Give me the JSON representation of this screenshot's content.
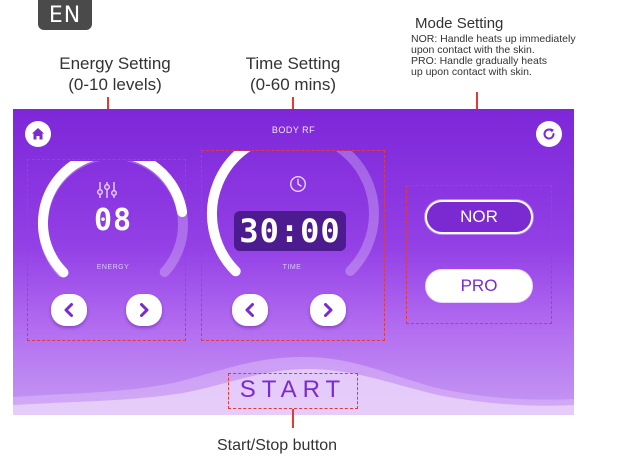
{
  "lang_badge": "EN",
  "callouts": {
    "energy": {
      "line1": "Energy Setting",
      "line2": "(0-10 levels)"
    },
    "time": {
      "line1": "Time Setting",
      "line2": "(0-60 mins)"
    },
    "mode": {
      "title": "Mode Setting",
      "desc": [
        "NOR: Handle heats up immediately",
        "upon contact with the skin.",
        "PRO: Handle gradually heats",
        "up upon contact with skin."
      ]
    },
    "start_stop": "Start/Stop button"
  },
  "screen": {
    "title": "BODY RF",
    "energy": {
      "value": "08",
      "label": "ENERGY",
      "level": 8,
      "max": 10
    },
    "time": {
      "value": "30:00",
      "label": "TIME",
      "minutes": 30,
      "max": 60
    },
    "modes": {
      "nor": "NOR",
      "pro": "PRO",
      "selected": "NOR"
    },
    "start_label": "START"
  },
  "colors": {
    "accent": "#7a2ad0",
    "callout_line": "#e53935",
    "screen_top": "#7d27d8",
    "screen_bottom": "#c59af3"
  },
  "icons": {
    "home": "home-icon",
    "refresh": "refresh-icon",
    "energy": "sliders-icon",
    "time": "clock-icon",
    "prev": "chevron-left-icon",
    "next": "chevron-right-icon"
  }
}
